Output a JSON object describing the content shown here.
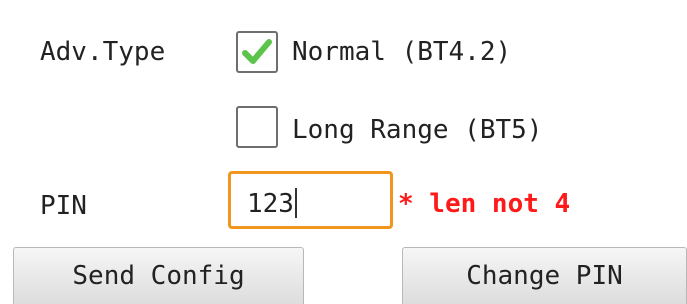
{
  "adv_type": {
    "label": "Adv.Type",
    "options": [
      {
        "label": "Normal (BT4.2)",
        "checked": true
      },
      {
        "label": "Long Range (BT5)",
        "checked": false
      }
    ]
  },
  "pin": {
    "label": "PIN",
    "value": "123",
    "error": "* len not 4"
  },
  "buttons": {
    "send_config": "Send Config",
    "change_pin": "Change PIN"
  },
  "colors": {
    "check_mark": "#5cc44a",
    "field_focus_border": "#f0961e",
    "error_text": "#ff1a1a"
  }
}
